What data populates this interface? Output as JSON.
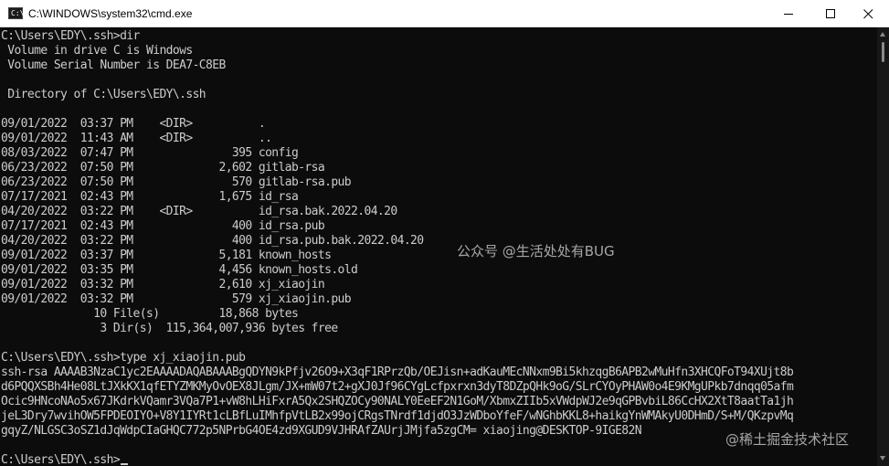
{
  "window": {
    "title": "C:\\WINDOWS\\system32\\cmd.exe",
    "icon_glyph": "C:\\",
    "controls": [
      "minimize-icon",
      "maximize-icon",
      "close-icon"
    ]
  },
  "terminal": {
    "lines": [
      "C:\\Users\\EDY\\.ssh>dir",
      " Volume in drive C is Windows",
      " Volume Serial Number is DEA7-C8EB",
      "",
      " Directory of C:\\Users\\EDY\\.ssh",
      "",
      "09/01/2022  03:37 PM    <DIR>          .",
      "09/01/2022  11:43 AM    <DIR>          ..",
      "08/03/2022  07:47 PM               395 config",
      "06/23/2022  07:50 PM             2,602 gitlab-rsa",
      "06/23/2022  07:50 PM               570 gitlab-rsa.pub",
      "07/17/2021  02:43 PM             1,675 id_rsa",
      "04/20/2022  03:22 PM    <DIR>          id_rsa.bak.2022.04.20",
      "07/17/2021  02:43 PM               400 id_rsa.pub",
      "04/20/2022  03:22 PM               400 id_rsa.pub.bak.2022.04.20",
      "09/01/2022  03:37 PM             5,181 known_hosts",
      "09/01/2022  03:35 PM             4,456 known_hosts.old",
      "09/01/2022  03:32 PM             2,610 xj_xiaojin",
      "09/01/2022  03:32 PM               579 xj_xiaojin.pub",
      "              10 File(s)         18,868 bytes",
      "               3 Dir(s)  115,364,007,936 bytes free",
      "",
      "C:\\Users\\EDY\\.ssh>type xj_xiaojin.pub",
      "ssh-rsa AAAAB3NzaC1yc2EAAAADAQABAAABgQDYN9kPfjv26O9+X3qF1RPrzQb/OEJisn+adKauMEcNNxm9Bi5khzqgB6APB2wMuHfn3XHCQFoT94XUjt8b",
      "d6PQQXSBh4He08LtJXkKX1qfETYZMKMyOvOEX8JLgm/JX+mW07t2+gXJ0Jf96CYgLcfpxrxn3dyT8DZpQHk9oG/SLrCYOyPHAW0o4E9KMgUPkb7dnqq05afm",
      "Ocic9HNcoNAo5x67JKdrkVQamr3VQa7P1+vW8hLHiFxrA5Qx2SHQZOCy90NALY0EeEF2N1GoM/XbmxZIIb5xVWdpWJ2e9qGPBvbiL86CcHX2XtT8aatTa1jh",
      "jeL3Dry7wvihOW5FPDEOIYO+V8Y1IYRt1cLBfLuIMhfpVtLB2x99ojCRgsTNrdf1djdO3JzWDboYfeF/wNGhbKKL8+haikgYnWMAkyU0DHmD/S+M/QKzpvMq",
      "gqyZ/NLGSC3oSZ1dJqWdpCIaGHQC772p5NPrbG4OE4zd9XGUD9VJHRAfZAUrjJMjfa5zgCM= xiaojing@DESKTOP-9IGE82N",
      ""
    ],
    "prompt": "C:\\Users\\EDY\\.ssh>"
  },
  "watermarks": {
    "wechat": "公众号 @生活处处有BUG",
    "juejin": "@稀土掘金技术社区"
  }
}
